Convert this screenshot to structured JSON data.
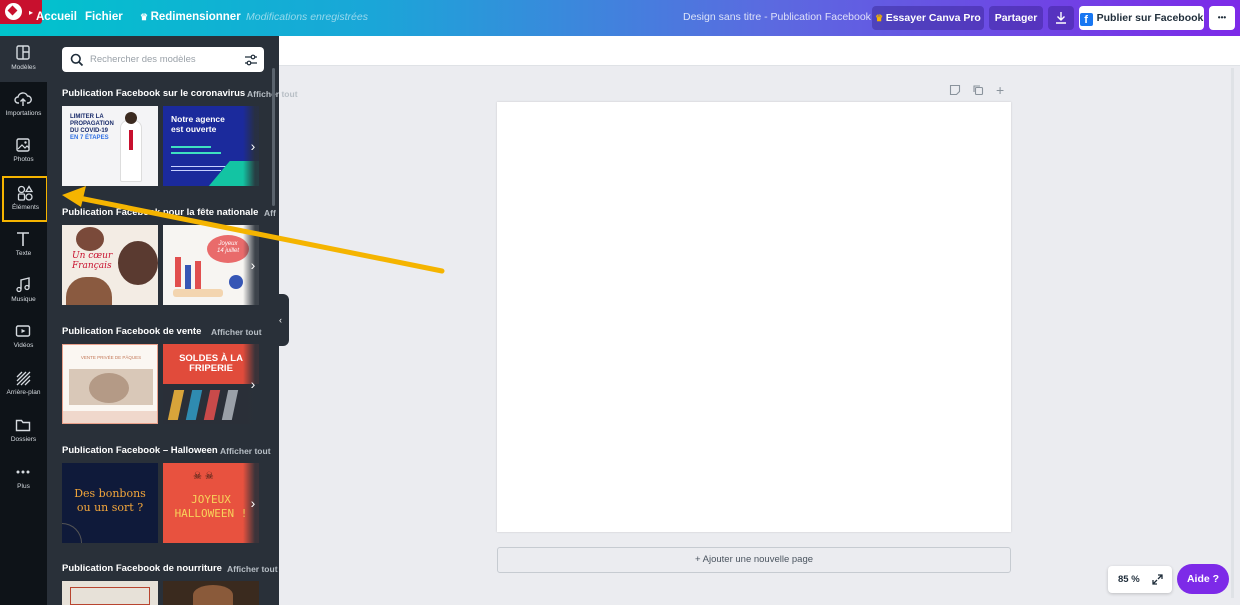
{
  "topbar": {
    "home": "Accueil",
    "file": "Fichier",
    "resize": "Redimensionner",
    "status": "Modifications enregistrées",
    "doc_title": "Design sans titre - Publication Facebook",
    "try_pro": "Essayer Canva Pro",
    "share": "Partager",
    "publish": "Publier sur Facebook",
    "more": "•••"
  },
  "leftnav": [
    {
      "label": "Modèles",
      "icon": "templates-icon"
    },
    {
      "label": "Importations",
      "icon": "upload-cloud-icon"
    },
    {
      "label": "Photos",
      "icon": "photo-icon"
    },
    {
      "label": "Éléments",
      "icon": "shapes-icon"
    },
    {
      "label": "Texte",
      "icon": "text-icon"
    },
    {
      "label": "Musique",
      "icon": "music-icon"
    },
    {
      "label": "Vidéos",
      "icon": "video-icon"
    },
    {
      "label": "Arrière-plan",
      "icon": "background-icon"
    },
    {
      "label": "Dossiers",
      "icon": "folder-icon"
    },
    {
      "label": "Plus",
      "icon": "more-icon"
    }
  ],
  "panel": {
    "search_placeholder": "Rechercher des modèles",
    "sections": [
      {
        "title": "Publication Facebook sur le coronavirus",
        "see_all": "Afficher tout",
        "thumbs": [
          {
            "lines": [
              "LIMITER LA",
              "PROPAGATION",
              "DU COVID-19",
              "EN 7 ÉTAPES"
            ]
          },
          {
            "lines": [
              "Notre agence",
              "est ouverte"
            ]
          }
        ]
      },
      {
        "title": "Publication Facebook pour la fête nationale",
        "see_all": "Afficher tout",
        "thumbs": [
          {
            "lines": [
              "Un cœur",
              "Français"
            ]
          },
          {
            "lines": [
              "Joyeux",
              "14 juillet"
            ]
          }
        ]
      },
      {
        "title": "Publication Facebook de vente",
        "see_all": "Afficher tout",
        "thumbs": [
          {
            "lines": [
              "VENTE PRIVÉE DE PÂQUES"
            ]
          },
          {
            "lines": [
              "SOLDES À LA",
              "FRIPERIE"
            ]
          }
        ]
      },
      {
        "title": "Publication Facebook – Halloween",
        "see_all": "Afficher tout",
        "thumbs": [
          {
            "lines": [
              "Des bonbons",
              "ou un sort ?"
            ]
          },
          {
            "lines": [
              "JOYEUX",
              "HALLOWEEN !"
            ]
          }
        ]
      },
      {
        "title": "Publication Facebook de nourriture",
        "see_all": "Afficher tout",
        "thumbs": []
      }
    ]
  },
  "canvas": {
    "add_page": "+ Ajouter une nouvelle page"
  },
  "zoom": "85 %",
  "help": "Aide  ?",
  "colors": {
    "brand_purple": "#7d2ae8",
    "brand_teal": "#00c4cc",
    "highlight": "#f5b400",
    "sidebar_bg": "#0e1318",
    "panel_bg": "#293039"
  }
}
